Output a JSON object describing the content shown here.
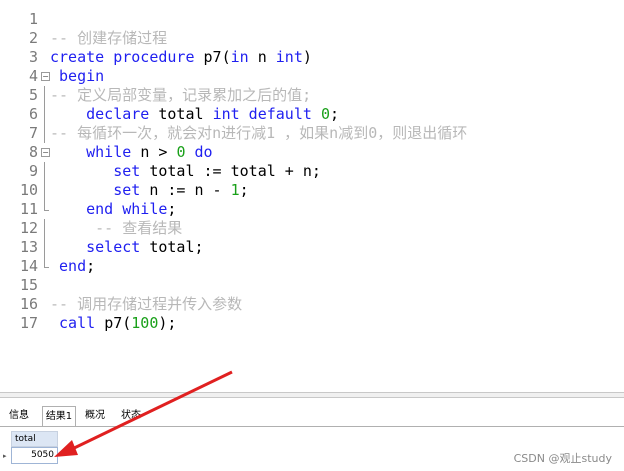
{
  "editor": {
    "lines": [
      {
        "n": "1",
        "fold": "",
        "segs": []
      },
      {
        "n": "2",
        "fold": "",
        "segs": [
          {
            "t": "-- 创建存储过程",
            "c": "cm"
          }
        ]
      },
      {
        "n": "3",
        "fold": "",
        "segs": [
          {
            "t": "create procedure ",
            "c": "kw"
          },
          {
            "t": "p7(",
            "c": "txt"
          },
          {
            "t": "in",
            "c": "kw"
          },
          {
            "t": " n ",
            "c": "txt"
          },
          {
            "t": "int",
            "c": "kw"
          },
          {
            "t": ")",
            "c": "txt"
          }
        ]
      },
      {
        "n": "4",
        "fold": "open",
        "segs": [
          {
            "t": " begin",
            "c": "kw"
          }
        ]
      },
      {
        "n": "5",
        "fold": "bar",
        "segs": [
          {
            "t": "-- 定义局部变量，记录累加之后的值;",
            "c": "cm"
          }
        ]
      },
      {
        "n": "6",
        "fold": "bar",
        "segs": [
          {
            "t": "    declare ",
            "c": "kw"
          },
          {
            "t": "total ",
            "c": "txt"
          },
          {
            "t": "int default ",
            "c": "kw"
          },
          {
            "t": "0",
            "c": "num"
          },
          {
            "t": ";",
            "c": "txt"
          }
        ]
      },
      {
        "n": "7",
        "fold": "bar",
        "segs": [
          {
            "t": "-- 每循环一次，就会对n进行减1 ，如果n减到0，则退出循环",
            "c": "cm"
          }
        ]
      },
      {
        "n": "8",
        "fold": "open",
        "segs": [
          {
            "t": "    while ",
            "c": "kw"
          },
          {
            "t": "n > ",
            "c": "txt"
          },
          {
            "t": "0",
            "c": "num"
          },
          {
            "t": " do",
            "c": "kw"
          }
        ]
      },
      {
        "n": "9",
        "fold": "bar",
        "segs": [
          {
            "t": "       set ",
            "c": "kw"
          },
          {
            "t": "total := total + n;",
            "c": "txt"
          }
        ]
      },
      {
        "n": "10",
        "fold": "bar",
        "segs": [
          {
            "t": "       set ",
            "c": "kw"
          },
          {
            "t": "n := n - ",
            "c": "txt"
          },
          {
            "t": "1",
            "c": "num"
          },
          {
            "t": ";",
            "c": "txt"
          }
        ]
      },
      {
        "n": "11",
        "fold": "end",
        "segs": [
          {
            "t": "    end while",
            "c": "kw"
          },
          {
            "t": ";",
            "c": "txt"
          }
        ]
      },
      {
        "n": "12",
        "fold": "bar",
        "segs": [
          {
            "t": "     -- 查看结果",
            "c": "cm"
          }
        ]
      },
      {
        "n": "13",
        "fold": "bar",
        "segs": [
          {
            "t": "    select ",
            "c": "kw"
          },
          {
            "t": "total;",
            "c": "txt"
          }
        ]
      },
      {
        "n": "14",
        "fold": "end",
        "segs": [
          {
            "t": " end",
            "c": "kw"
          },
          {
            "t": ";",
            "c": "txt"
          }
        ]
      },
      {
        "n": "15",
        "fold": "",
        "segs": []
      },
      {
        "n": "16",
        "fold": "",
        "segs": [
          {
            "t": "-- 调用存储过程并传入参数",
            "c": "cm"
          }
        ]
      },
      {
        "n": "17",
        "fold": "",
        "segs": [
          {
            "t": " call ",
            "c": "kw"
          },
          {
            "t": "p7(",
            "c": "txt"
          },
          {
            "t": "100",
            "c": "num"
          },
          {
            "t": ");",
            "c": "txt"
          }
        ]
      }
    ]
  },
  "result_tabs": [
    "信息",
    "结果1",
    "概况",
    "状态"
  ],
  "active_tab": "结果1",
  "result": {
    "column": "total",
    "value": "5050"
  },
  "watermark": "CSDN @观止study",
  "colors": {
    "keyword": "#1f1ff0",
    "comment": "#b8b8b8",
    "number": "#19a019",
    "arrow": "#e02020"
  }
}
